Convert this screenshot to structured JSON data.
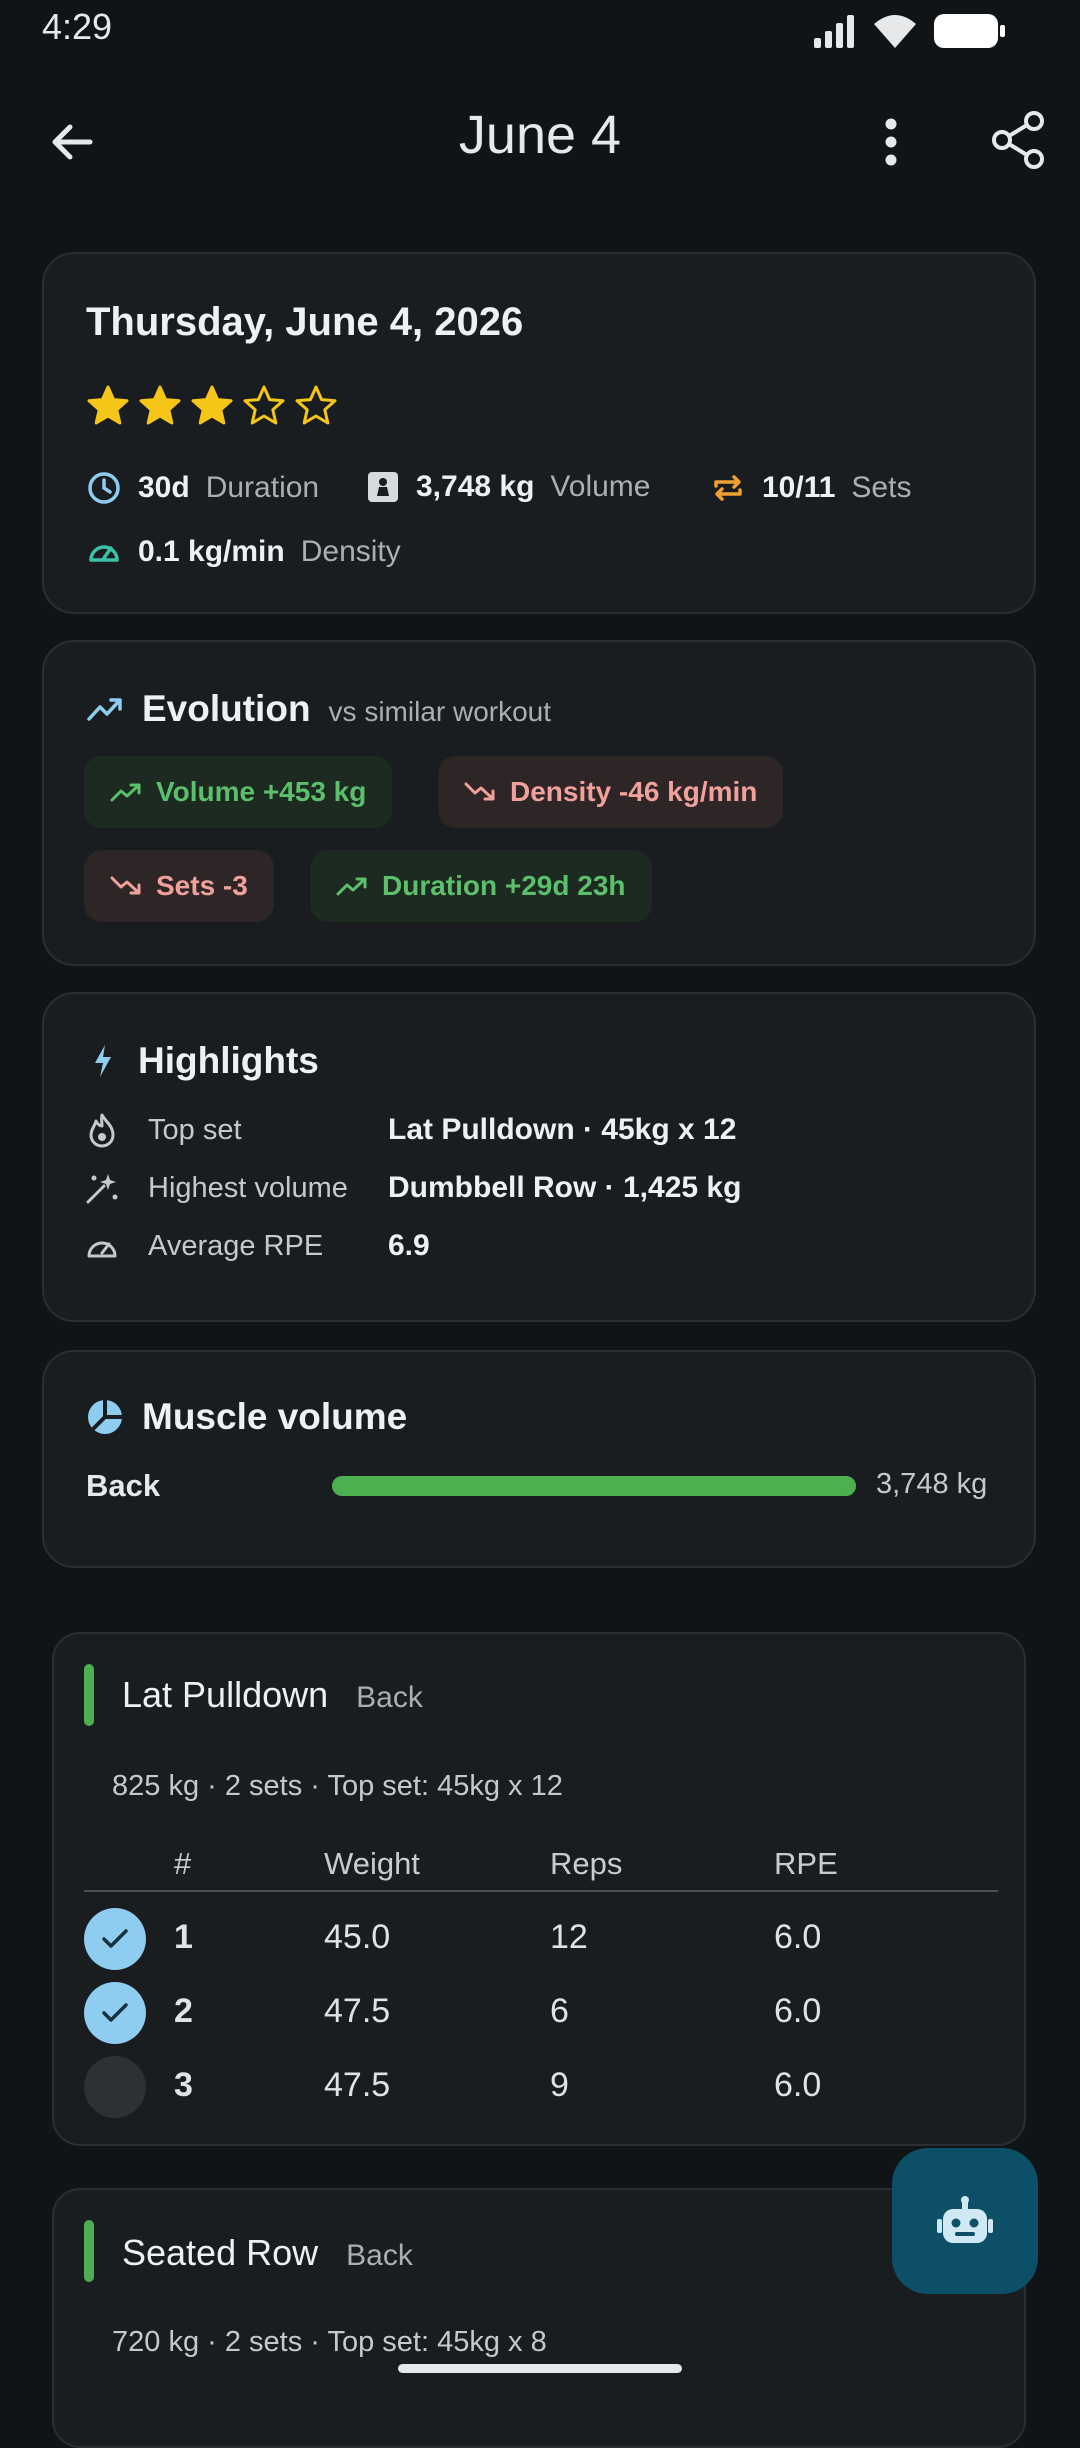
{
  "status_bar": {
    "time": "4:29"
  },
  "header": {
    "title": "June 4"
  },
  "summary": {
    "date": "Thursday, June 4, 2026",
    "rating": 3,
    "rating_max": 5,
    "stats": [
      {
        "value": "30d",
        "label": "Duration",
        "icon": "clock-icon"
      },
      {
        "value": "3,748 kg",
        "label": "Volume",
        "icon": "weight-icon"
      },
      {
        "value": "10/11",
        "label": "Sets",
        "icon": "repeat-icon"
      },
      {
        "value": "0.1 kg/min",
        "label": "Density",
        "icon": "speedometer-icon"
      }
    ]
  },
  "evolution": {
    "title": "Evolution",
    "subtitle": "vs similar workout",
    "chips": [
      {
        "text": "Volume +453 kg",
        "trend": "up"
      },
      {
        "text": "Density -46 kg/min",
        "trend": "down"
      },
      {
        "text": "Sets -3",
        "trend": "down"
      },
      {
        "text": "Duration +29d 23h",
        "trend": "up"
      }
    ]
  },
  "highlights": {
    "title": "Highlights",
    "rows": [
      {
        "label": "Top set",
        "value": "Lat Pulldown · 45kg x 12",
        "icon": "flame-icon"
      },
      {
        "label": "Highest volume",
        "value": "Dumbbell Row · 1,425 kg",
        "icon": "sparkle-icon"
      },
      {
        "label": "Average RPE",
        "value": "6.9",
        "icon": "gauge-icon"
      }
    ]
  },
  "muscle_volume": {
    "title": "Muscle volume",
    "muscle": "Back",
    "value": "3,748 kg",
    "fraction": 1.0
  },
  "exercises": [
    {
      "name": "Lat Pulldown",
      "muscle": "Back",
      "summary": "825 kg · 2 sets · Top set: 45kg x 12",
      "headers": [
        "#",
        "Weight",
        "Reps",
        "RPE"
      ],
      "sets": [
        {
          "num": "1",
          "weight": "45.0",
          "reps": "12",
          "rpe": "6.0",
          "done": true
        },
        {
          "num": "2",
          "weight": "47.5",
          "reps": "6",
          "rpe": "6.0",
          "done": true
        },
        {
          "num": "3",
          "weight": "47.5",
          "reps": "9",
          "rpe": "6.0",
          "done": false
        }
      ]
    },
    {
      "name": "Seated Row",
      "muscle": "Back",
      "summary": "720 kg · 2 sets · Top set: 45kg x 8"
    }
  ],
  "colors": {
    "background": "#111417",
    "card": "#1a1d20",
    "star": "#f5c518",
    "accent_blue": "#8ecdf0",
    "green": "#4caf50",
    "fab": "#0d4f66"
  }
}
